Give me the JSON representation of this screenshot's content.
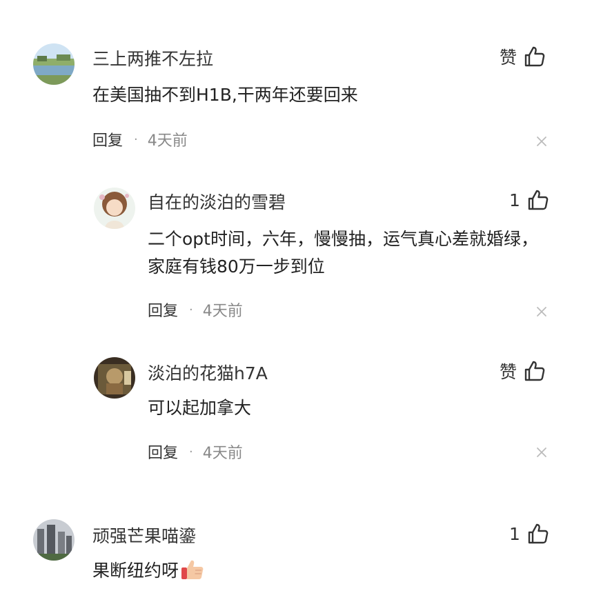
{
  "comments": [
    {
      "username": "三上两推不左拉",
      "content": "在美国抽不到H1B,干两年还要回来",
      "like_label": "赞",
      "reply_label": "回复",
      "separator": "·",
      "time": "4天前"
    },
    {
      "username": "自在的淡泊的雪碧",
      "content": "二个opt时间，六年，慢慢抽，运气真心差就婚绿，家庭有钱80万一步到位",
      "like_label": "1",
      "reply_label": "回复",
      "separator": "·",
      "time": "4天前"
    },
    {
      "username": "淡泊的花猫h7A",
      "content": "可以起加拿大",
      "like_label": "赞",
      "reply_label": "回复",
      "separator": "·",
      "time": "4天前"
    },
    {
      "username": "顽强芒果喵鎏",
      "content": "果断纽约呀",
      "like_label": "1",
      "emoji": "thumbs-up-emoji"
    }
  ],
  "icons": {
    "like": "thumbs-up-icon",
    "close": "close-icon"
  },
  "colors": {
    "text": "#222222",
    "meta": "#888888",
    "icon": "#333333",
    "close": "#bbbbbb"
  }
}
